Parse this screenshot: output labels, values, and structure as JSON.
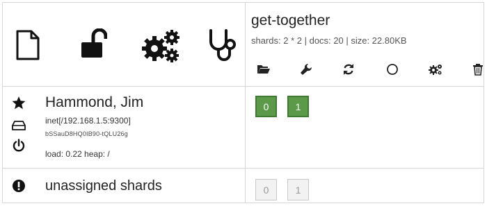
{
  "header": {
    "icons": [
      {
        "name": "file-icon"
      },
      {
        "name": "unlock-icon"
      },
      {
        "name": "gears-icon"
      },
      {
        "name": "stethoscope-icon"
      }
    ]
  },
  "index": {
    "name": "get-together",
    "stats": "shards: 2 * 2 | docs: 20 | size: 22.80KB",
    "tools": [
      {
        "name": "folder-open-icon"
      },
      {
        "name": "wrench-icon"
      },
      {
        "name": "refresh-icon"
      },
      {
        "name": "circle-icon"
      },
      {
        "name": "gears-small-icon"
      },
      {
        "name": "trash-icon"
      }
    ]
  },
  "node": {
    "name": "Hammond, Jim",
    "address": "inet[/192.168.1.5:9300]",
    "id": "bSSauD8HQ0IB90-tQLU26g",
    "load": "load: 0.22 heap: /",
    "icons": [
      {
        "name": "star-icon"
      },
      {
        "name": "hdd-icon"
      },
      {
        "name": "power-icon"
      }
    ],
    "shards": [
      "0",
      "1"
    ]
  },
  "unassigned": {
    "label": "unassigned shards",
    "icon": "exclamation-circle-icon",
    "shards": [
      "0",
      "1"
    ]
  },
  "colors": {
    "shard_active": "#5c9a4a",
    "shard_unassigned": "#f2f2f2",
    "border": "#d6d6d6"
  }
}
